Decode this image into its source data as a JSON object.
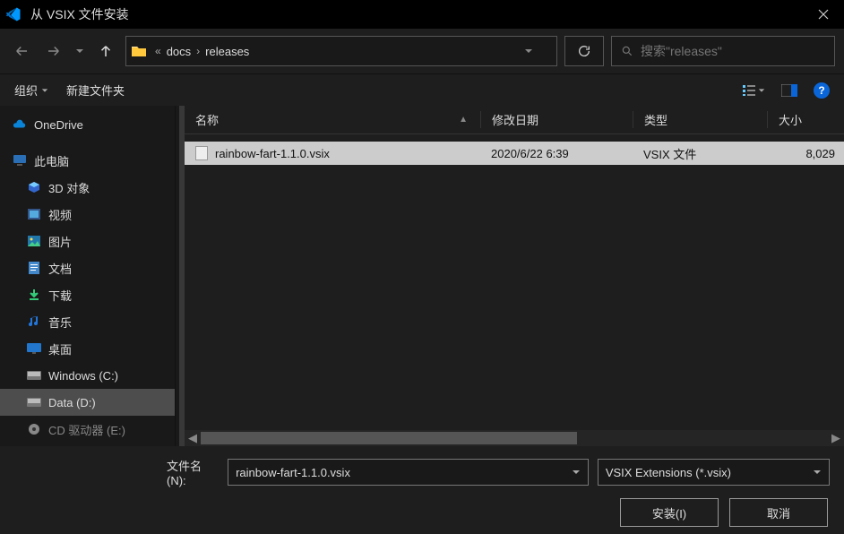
{
  "titlebar": {
    "title": "从 VSIX 文件安装"
  },
  "breadcrumb": {
    "seg1": "docs",
    "seg2": "releases"
  },
  "search": {
    "placeholder": "搜索\"releases\""
  },
  "orgbar": {
    "organize": "组织",
    "newfolder": "新建文件夹"
  },
  "tree": {
    "onedrive": "OneDrive",
    "thispc": "此电脑",
    "items": [
      {
        "label": "3D 对象"
      },
      {
        "label": "视频"
      },
      {
        "label": "图片"
      },
      {
        "label": "文档"
      },
      {
        "label": "下载"
      },
      {
        "label": "音乐"
      },
      {
        "label": "桌面"
      },
      {
        "label": "Windows (C:)"
      },
      {
        "label": "Data (D:)"
      },
      {
        "label": "CD 驱动器 (E:)"
      }
    ]
  },
  "columns": {
    "name": "名称",
    "date": "修改日期",
    "type": "类型",
    "size": "大小"
  },
  "files": [
    {
      "name": "rainbow-fart-1.1.0.vsix",
      "date": "2020/6/22 6:39",
      "type": "VSIX 文件",
      "size": "8,029"
    }
  ],
  "footer": {
    "filename_label": "文件名(N):",
    "filename_value": "rainbow-fart-1.1.0.vsix",
    "filter": "VSIX Extensions (*.vsix)",
    "open": "安装(I)",
    "cancel": "取消"
  }
}
